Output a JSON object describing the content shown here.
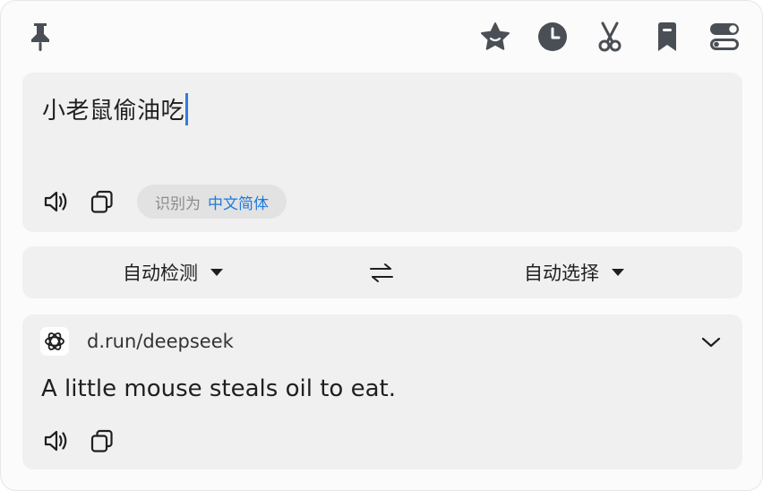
{
  "toolbar": {
    "left_icon": "pin-icon",
    "right_icons": [
      "star-icon",
      "history-clock-icon",
      "scissors-icon",
      "bookmark-icon",
      "toggle-settings-icon"
    ]
  },
  "input": {
    "text": "小老鼠偷油吃",
    "detect_prefix": "识别为",
    "detect_language": "中文简体",
    "speak_icon": "speaker-icon",
    "copy_icon": "copy-icon"
  },
  "languages": {
    "source": "自动检测",
    "target": "自动选择",
    "swap_icon": "swap-arrows-icon"
  },
  "result": {
    "service_name": "d.run/deepseek",
    "text": "A little mouse steals oil to eat.",
    "speak_icon": "speaker-icon",
    "copy_icon": "copy-icon"
  },
  "colors": {
    "accent": "#1f7ae0",
    "icon": "#4a4f55",
    "card_bg": "#f0f0f0",
    "window_bg": "#fbfbfb"
  }
}
